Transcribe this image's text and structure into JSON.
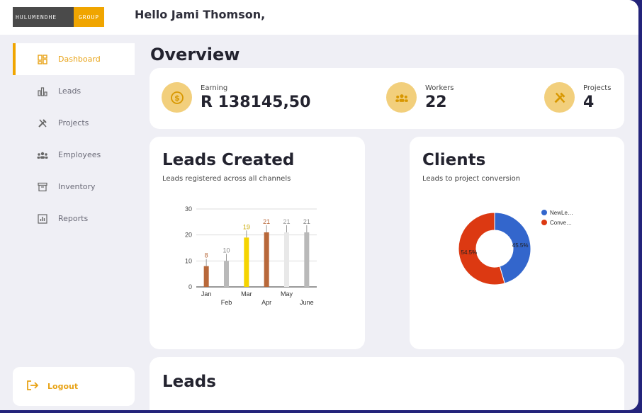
{
  "logo": {
    "left_text": "HULUMENDHE",
    "right_text": "GROUP"
  },
  "header": {
    "greeting": "Hello Jami Thomson,"
  },
  "sidebar": {
    "items": [
      {
        "label": "Dashboard",
        "icon": "dashboard-icon",
        "active": true
      },
      {
        "label": "Leads",
        "icon": "bar-chart-icon"
      },
      {
        "label": "Projects",
        "icon": "tools-icon"
      },
      {
        "label": "Employees",
        "icon": "people-icon"
      },
      {
        "label": "Inventory",
        "icon": "archive-icon"
      },
      {
        "label": "Reports",
        "icon": "report-icon"
      }
    ],
    "logout": "Logout"
  },
  "overview": {
    "title": "Overview"
  },
  "stats": {
    "earning": {
      "label": "Earning",
      "value": "R 138145,50",
      "icon": "dollar-icon"
    },
    "workers": {
      "label": "Workers",
      "value": "22",
      "icon": "people-icon"
    },
    "projects": {
      "label": "Projects",
      "value": "4",
      "icon": "tools-icon"
    }
  },
  "leads_card": {
    "title": "Leads Created",
    "subtitle": "Leads registered across all channels"
  },
  "clients_card": {
    "title": "Clients",
    "subtitle": "Leads to project conversion"
  },
  "bottom_card": {
    "title": "Leads"
  },
  "chart_data": [
    {
      "type": "bar",
      "categories": [
        "Jan",
        "Feb",
        "Mar",
        "Apr",
        "May",
        "June"
      ],
      "values": [
        8,
        10,
        19,
        21,
        21,
        21
      ],
      "bar_colors": [
        "#b8683a",
        "#b9b9b9",
        "#f5d400",
        "#b8683a",
        "#e8e8e8",
        "#b9b9b9"
      ],
      "label_colors": [
        "#b8683a",
        "#888888",
        "#c9a800",
        "#b8683a",
        "#999999",
        "#888888"
      ],
      "ylim": [
        0,
        30
      ],
      "yticks": [
        0,
        10,
        20,
        30
      ],
      "grid": true,
      "title": "",
      "xlabel": "",
      "ylabel": ""
    },
    {
      "type": "pie",
      "donut": true,
      "labels": [
        "NewLe…",
        "Conve…"
      ],
      "values": [
        45.5,
        54.5
      ],
      "value_labels": [
        "45.5%",
        "54.5%"
      ],
      "colors": [
        "#3366cc",
        "#dc3912"
      ],
      "legend": "right"
    }
  ]
}
